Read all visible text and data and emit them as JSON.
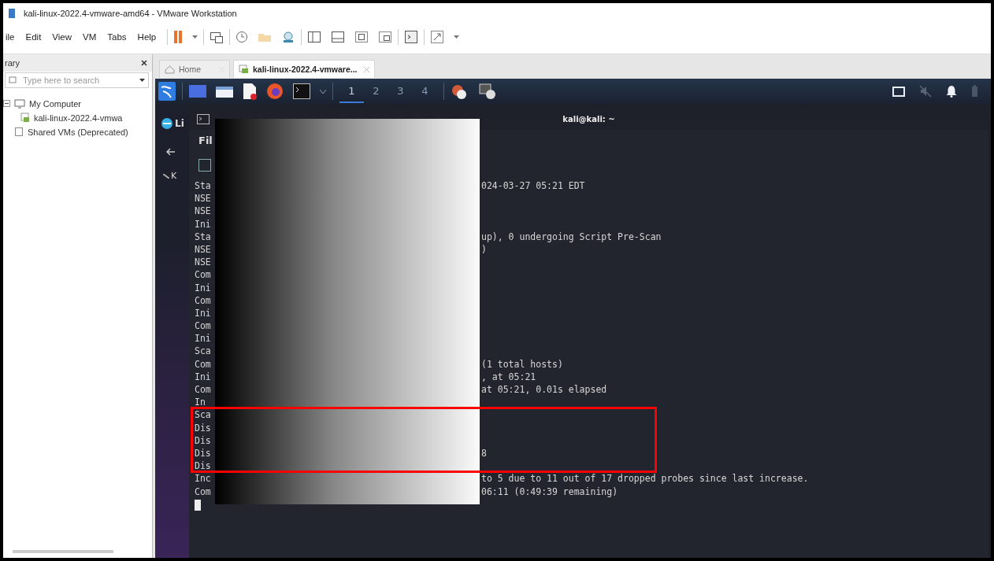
{
  "window": {
    "title": "kali-linux-2022.4-vmware-amd64 - VMware Workstation"
  },
  "menu": [
    "ile",
    "Edit",
    "View",
    "VM",
    "Tabs",
    "Help"
  ],
  "library": {
    "title": "rary",
    "search": {
      "placeholder": "Type here to search"
    },
    "tree": [
      {
        "label": "My Computer",
        "expanded": true,
        "children": [
          {
            "label": "kali-linux-2022.4-vmwa"
          }
        ]
      },
      {
        "label": "Shared VMs (Deprecated)"
      }
    ]
  },
  "tabs": [
    {
      "label": "Home",
      "selected": false
    },
    {
      "label": "kali-linux-2022.4-vmware...",
      "selected": true
    }
  ],
  "guest": {
    "workspaces": [
      {
        "label": "1",
        "selected": true
      },
      {
        "label": "2",
        "selected": false
      },
      {
        "label": "3",
        "selected": false
      },
      {
        "label": "4",
        "selected": false
      }
    ],
    "dock": {
      "app_label": "Li",
      "side_label": "K"
    },
    "terminal": {
      "title": "kali@kali: ~",
      "menu_label": "Fil",
      "cursor": true,
      "lines": [
        {
          "start": "Sta",
          "end": "024-03-27 05:21 EDT"
        },
        {
          "start": "NSE"
        },
        {
          "start": "NSE"
        },
        {
          "start": "Ini"
        },
        {
          "start": "Sta",
          "end": "up), 0 undergoing Script Pre-Scan"
        },
        {
          "start": "NSE",
          "end": ")"
        },
        {
          "start": "NSE"
        },
        {
          "start": "Com"
        },
        {
          "start": "Ini"
        },
        {
          "start": "Com"
        },
        {
          "start": "Ini"
        },
        {
          "start": "Com"
        },
        {
          "start": "Ini"
        },
        {
          "start": "Sca"
        },
        {
          "start": "Com",
          "end": "(1 total hosts)"
        },
        {
          "start": "Ini",
          "end": ", at 05:21"
        },
        {
          "start": "Com",
          "end": "at 05:21, 0.01s elapsed"
        },
        {
          "start": "In"
        },
        {
          "start": "Sca"
        },
        {
          "start": "Dis"
        },
        {
          "start": "Dis"
        },
        {
          "start": "Dis",
          "end": "8"
        },
        {
          "start": "Dis"
        },
        {
          "start": "Inc",
          "end": "to 5 due to 11 out of 17 dropped probes since last increase."
        },
        {
          "start": "Com",
          "end": "06:11 (0:49:39 remaining)"
        }
      ]
    }
  }
}
